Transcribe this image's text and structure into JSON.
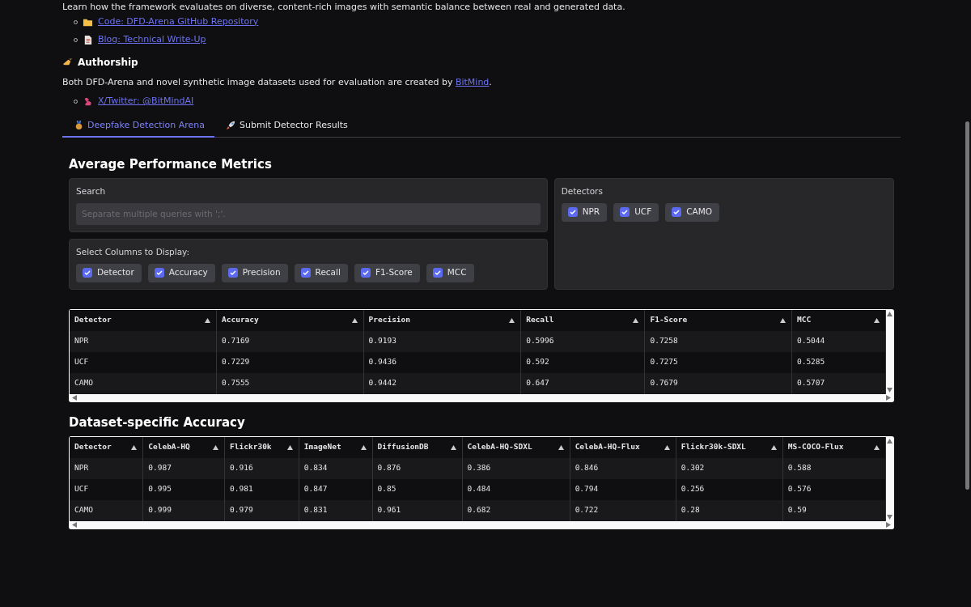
{
  "intro": {
    "text": "Learn how the framework evaluates on diverse, content-rich images with semantic balance between real and generated data.",
    "links": [
      {
        "kind": "folder",
        "label": "Code: DFD-Arena GitHub Repository"
      },
      {
        "kind": "page",
        "label": "Blog: Technical Write-Up"
      }
    ]
  },
  "authorship": {
    "heading": "Authorship",
    "sentence": "Both DFD-Arena and novel synthetic image datasets used for evaluation are created by ",
    "link": "BitMind",
    "end": ".",
    "links": [
      {
        "kind": "bird",
        "label": "X/Twitter: @BitMindAI"
      }
    ]
  },
  "tabs": [
    {
      "kind": "medal",
      "label": "Deepfake Detection Arena",
      "selected": true
    },
    {
      "kind": "rocket",
      "label": "Submit Detector Results",
      "selected": false
    }
  ],
  "metrics": {
    "title": "Average Performance Metrics",
    "search": {
      "label": "Search",
      "placeholder": "Separate multiple queries with ';'."
    },
    "columns_filter": {
      "label": "Select Columns to Display:",
      "options": [
        {
          "label": "Detector",
          "checked": true
        },
        {
          "label": "Accuracy",
          "checked": true
        },
        {
          "label": "Precision",
          "checked": true
        },
        {
          "label": "Recall",
          "checked": true
        },
        {
          "label": "F1-Score",
          "checked": true
        },
        {
          "label": "MCC",
          "checked": true
        }
      ]
    },
    "detectors_filter": {
      "label": "Detectors",
      "options": [
        {
          "label": "NPR",
          "checked": true
        },
        {
          "label": "UCF",
          "checked": true
        },
        {
          "label": "CAMO",
          "checked": true
        }
      ]
    },
    "table": {
      "columns": [
        "Detector",
        "Accuracy",
        "Precision",
        "Recall",
        "F1-Score",
        "MCC"
      ],
      "rows": [
        [
          "NPR",
          "0.7169",
          "0.9193",
          "0.5996",
          "0.7258",
          "0.5044"
        ],
        [
          "UCF",
          "0.7229",
          "0.9436",
          "0.592",
          "0.7275",
          "0.5285"
        ],
        [
          "CAMO",
          "0.7555",
          "0.9442",
          "0.647",
          "0.7679",
          "0.5707"
        ]
      ]
    }
  },
  "dataset": {
    "title": "Dataset-specific Accuracy",
    "table": {
      "columns": [
        "Detector",
        "CelebA-HQ",
        "Flickr30k",
        "ImageNet",
        "DiffusionDB",
        "CelebA-HQ-SDXL",
        "CelebA-HQ-Flux",
        "Flickr30k-SDXL",
        "MS-COCO-Flux"
      ],
      "rows": [
        [
          "NPR",
          "0.987",
          "0.916",
          "0.834",
          "0.876",
          "0.386",
          "0.846",
          "0.302",
          "0.588"
        ],
        [
          "UCF",
          "0.995",
          "0.981",
          "0.847",
          "0.85",
          "0.484",
          "0.794",
          "0.256",
          "0.576"
        ],
        [
          "CAMO",
          "0.999",
          "0.979",
          "0.831",
          "0.961",
          "0.682",
          "0.722",
          "0.28",
          "0.59"
        ]
      ]
    }
  }
}
